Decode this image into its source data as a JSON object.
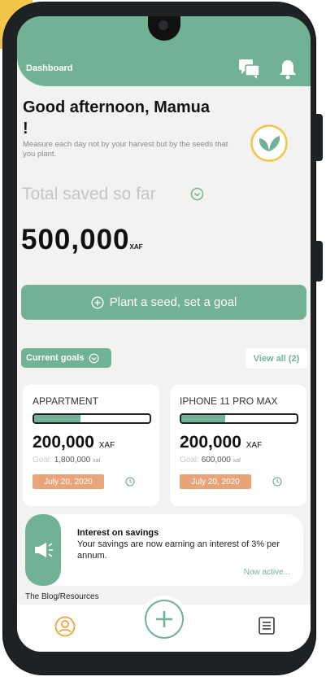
{
  "header": {
    "title": "Dashboard",
    "icons": [
      "chat-icon",
      "bell-icon"
    ]
  },
  "greeting": {
    "line": "Good afternoon, Mamua !",
    "quote": "Measure each day not by your harvest but by the seeds that you plant."
  },
  "savings": {
    "label": "Total saved so far",
    "amount": "500,000",
    "currency": "XAF"
  },
  "plant_button": {
    "label": "Plant a seed, set a goal"
  },
  "goals": {
    "label": "Current goals",
    "view_all": "View all (2)",
    "items": [
      {
        "name": "APPARTMENT",
        "amount": "200,000",
        "currency": "XAF",
        "goal_label": "Goal:",
        "goal_value": "1,800,000",
        "goal_currency": "xaf",
        "date": "July 20, 2020",
        "progress": 0.4
      },
      {
        "name": "IPHONE 11 PRO MAX",
        "amount": "200,000",
        "currency": "XAF",
        "goal_label": "Goal:",
        "goal_value": "600,000",
        "goal_currency": "xaf",
        "date": "July 20, 2020",
        "progress": 0.38
      }
    ]
  },
  "interest": {
    "title": "Interest on savings",
    "text": "Your savings are now earning an interest of 3% per annum.",
    "status": "Now active..."
  },
  "blog": {
    "label": "The Blog/Resources"
  },
  "colors": {
    "primary": "#71b195",
    "accent_date": "#e9a47a",
    "page_accent": "#f1c64a"
  }
}
